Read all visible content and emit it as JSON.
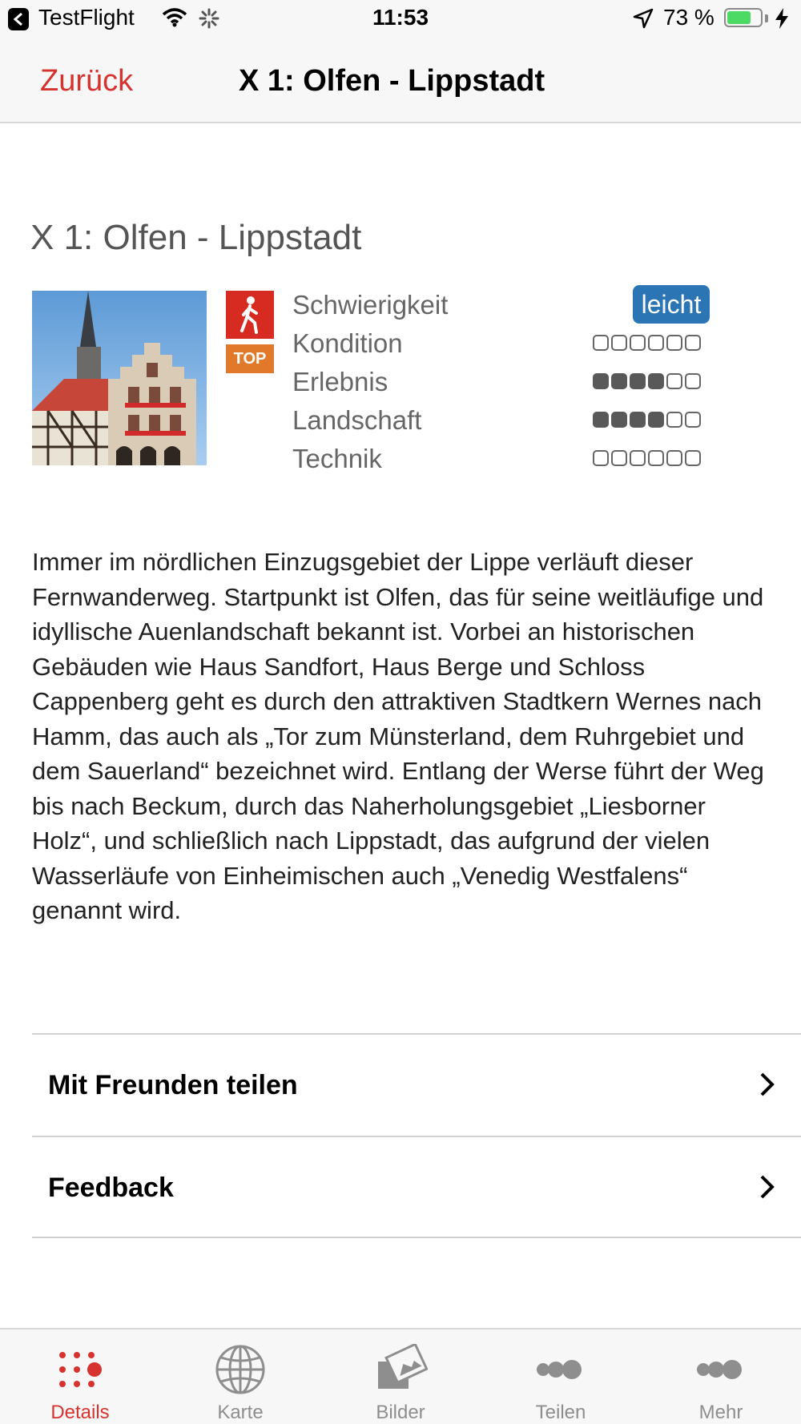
{
  "status_bar": {
    "app": "TestFlight",
    "time": "11:53",
    "battery_percent": "73 %",
    "battery_level": 0.73
  },
  "nav": {
    "back_label": "Zurück",
    "title": "X 1: Olfen - Lippstadt"
  },
  "tour": {
    "title": "X 1: Olfen - Lippstadt",
    "badge": "TOP",
    "ratings": [
      {
        "label": "Schwierigkeit",
        "value": "leicht"
      },
      {
        "label": "Kondition",
        "filled": 0,
        "total": 6
      },
      {
        "label": "Erlebnis",
        "filled": 4,
        "total": 6
      },
      {
        "label": "Landschaft",
        "filled": 4,
        "total": 6
      },
      {
        "label": "Technik",
        "filled": 0,
        "total": 6
      }
    ],
    "description": "Immer im nördlichen Einzugsgebiet der Lippe verläuft dieser Fernwanderweg. Startpunkt ist Olfen, das für seine weitläufige und idyllische Auenlandschaft bekannt ist. Vorbei an historischen Gebäuden wie Haus Sandfort, Haus Berge und Schloss Cappenberg geht es durch den attraktiven Stadtkern Wernes nach Hamm, das auch als „Tor zum Münsterland, dem Ruhrgebiet und dem Sauerland“ bezeichnet wird. Entlang der Werse führt der Weg bis nach Beckum, durch das Naherholungsgebiet „Liesborner Holz“, und schließlich nach Lippstadt, das aufgrund der vielen Wasserläufe von Einheimischen auch „Venedig Westfalens“ genannt wird."
  },
  "actions": [
    {
      "label": "Mit Freunden teilen"
    },
    {
      "label": "Feedback"
    }
  ],
  "tabs": [
    {
      "label": "Details",
      "icon": "dots-grid-icon",
      "active": true
    },
    {
      "label": "Karte",
      "icon": "globe-icon",
      "active": false
    },
    {
      "label": "Bilder",
      "icon": "photos-icon",
      "active": false
    },
    {
      "label": "Teilen",
      "icon": "share-dots-icon",
      "active": false
    },
    {
      "label": "Mehr",
      "icon": "more-dots-icon",
      "active": false
    }
  ],
  "colors": {
    "accent": "#d7332e",
    "difficulty_pill": "#2c75b4",
    "top_badge": "#e07a2a",
    "hiker_icon_bg": "#d72a20"
  }
}
